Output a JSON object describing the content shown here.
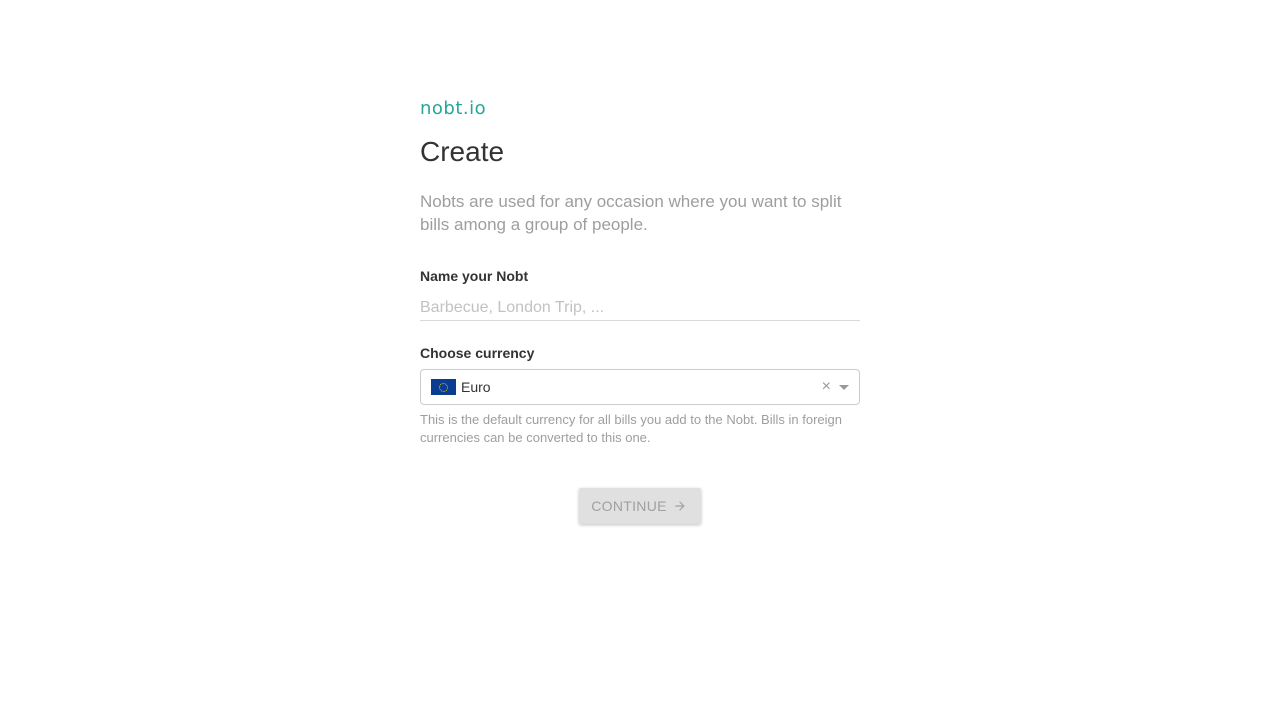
{
  "brand": {
    "logo_text": "nobt.io",
    "color": "#26a69a"
  },
  "page": {
    "title": "Create",
    "intro": "Nobts are used for any occasion where you want to split bills among a group of people."
  },
  "name_field": {
    "label": "Name your Nobt",
    "value": "",
    "placeholder": "Barbecue, London Trip, ..."
  },
  "currency_field": {
    "label": "Choose currency",
    "selected": "Euro",
    "flag_icon": "eu-flag-icon",
    "clear_symbol": "×",
    "help": "This is the default currency for all bills you add to the Nobt. Bills in foreign currencies can be converted to this one."
  },
  "continue_button": {
    "label": "CONTINUE",
    "icon": "arrow-right-icon",
    "disabled": true
  }
}
